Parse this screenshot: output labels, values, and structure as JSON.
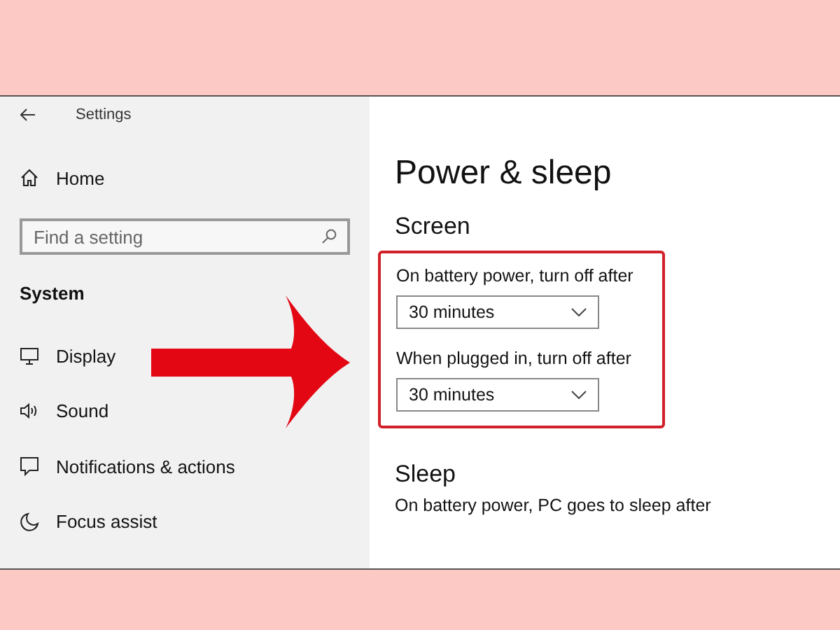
{
  "window": {
    "title": "Settings"
  },
  "sidebar": {
    "home": "Home",
    "search": {
      "placeholder": "Find a setting"
    },
    "section": "System",
    "items": [
      {
        "kind": "display",
        "label": "Display"
      },
      {
        "kind": "sound",
        "label": "Sound"
      },
      {
        "kind": "notifications",
        "label": "Notifications & actions"
      },
      {
        "kind": "focus",
        "label": "Focus assist"
      }
    ]
  },
  "content": {
    "title": "Power & sleep",
    "sections": [
      {
        "heading": "Screen",
        "highlighted": true,
        "settings": [
          {
            "label": "On battery power, turn off after",
            "value": "30 minutes"
          },
          {
            "label": "When plugged in, turn off after",
            "value": "30 minutes"
          }
        ]
      },
      {
        "heading": "Sleep",
        "highlighted": false,
        "settings": [
          {
            "label": "On battery power, PC goes to sleep after"
          }
        ]
      }
    ]
  }
}
